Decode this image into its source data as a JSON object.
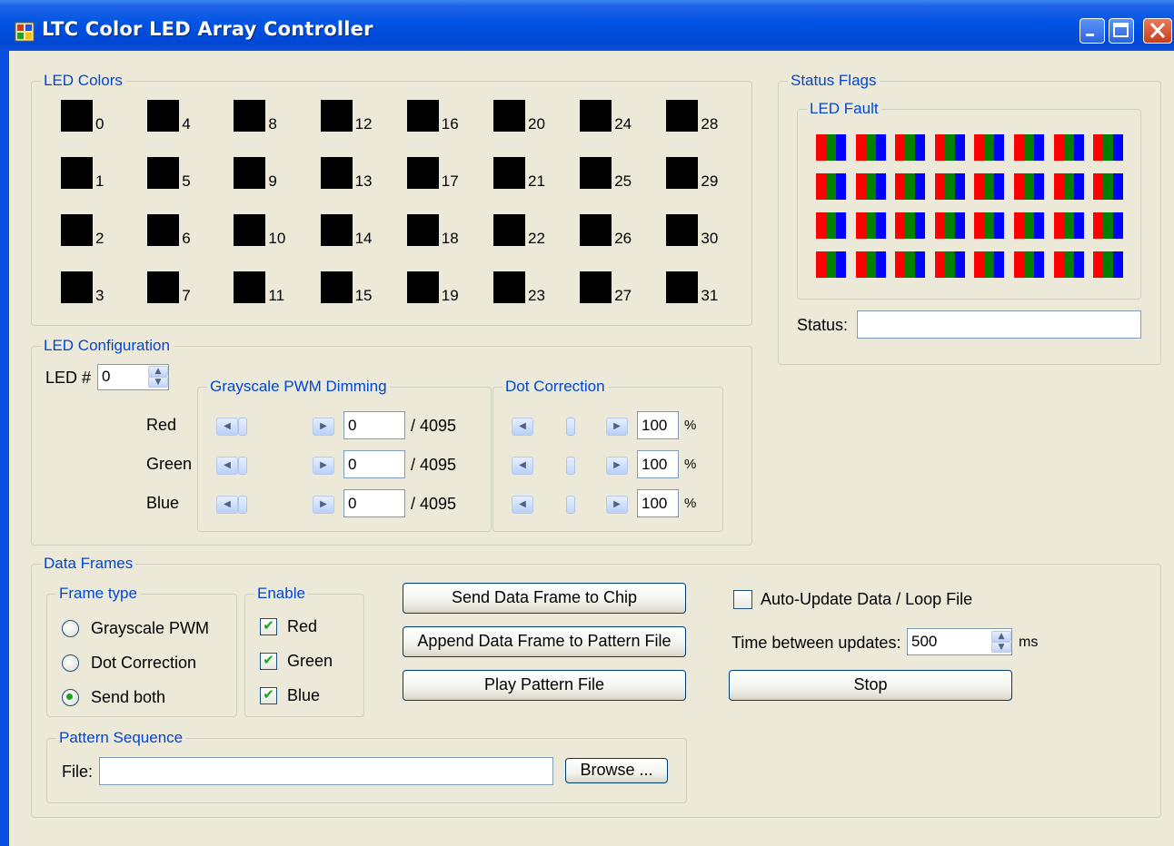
{
  "window": {
    "title": "LTC Color LED Array Controller"
  },
  "led_colors": {
    "label": "LED Colors",
    "leds": [
      {
        "num": "0",
        "col": 0,
        "row": 0
      },
      {
        "num": "1",
        "col": 0,
        "row": 1
      },
      {
        "num": "2",
        "col": 0,
        "row": 2
      },
      {
        "num": "3",
        "col": 0,
        "row": 3
      },
      {
        "num": "4",
        "col": 1,
        "row": 0
      },
      {
        "num": "5",
        "col": 1,
        "row": 1
      },
      {
        "num": "6",
        "col": 1,
        "row": 2
      },
      {
        "num": "7",
        "col": 1,
        "row": 3
      },
      {
        "num": "8",
        "col": 2,
        "row": 0
      },
      {
        "num": "9",
        "col": 2,
        "row": 1
      },
      {
        "num": "10",
        "col": 2,
        "row": 2
      },
      {
        "num": "11",
        "col": 2,
        "row": 3
      },
      {
        "num": "12",
        "col": 3,
        "row": 0
      },
      {
        "num": "13",
        "col": 3,
        "row": 1
      },
      {
        "num": "14",
        "col": 3,
        "row": 2
      },
      {
        "num": "15",
        "col": 3,
        "row": 3
      },
      {
        "num": "16",
        "col": 4,
        "row": 0
      },
      {
        "num": "17",
        "col": 4,
        "row": 1
      },
      {
        "num": "18",
        "col": 4,
        "row": 2
      },
      {
        "num": "19",
        "col": 4,
        "row": 3
      },
      {
        "num": "20",
        "col": 5,
        "row": 0
      },
      {
        "num": "21",
        "col": 5,
        "row": 1
      },
      {
        "num": "22",
        "col": 5,
        "row": 2
      },
      {
        "num": "23",
        "col": 5,
        "row": 3
      },
      {
        "num": "24",
        "col": 6,
        "row": 0
      },
      {
        "num": "25",
        "col": 6,
        "row": 1
      },
      {
        "num": "26",
        "col": 6,
        "row": 2
      },
      {
        "num": "27",
        "col": 6,
        "row": 3
      },
      {
        "num": "28",
        "col": 7,
        "row": 0
      },
      {
        "num": "29",
        "col": 7,
        "row": 1
      },
      {
        "num": "30",
        "col": 7,
        "row": 2
      },
      {
        "num": "31",
        "col": 7,
        "row": 3
      }
    ],
    "led_color": "#000000"
  },
  "status_flags": {
    "label": "Status Flags",
    "led_fault": {
      "label": "LED Fault",
      "colors": [
        "#ff0000",
        "#008000",
        "#0000ff"
      ],
      "rows": 4,
      "cols": 8
    },
    "status_label": "Status:",
    "status_value": ""
  },
  "led_config": {
    "label": "LED Configuration",
    "led_num_label": "LED #",
    "led_num_value": "0",
    "grayscale": {
      "label": "Grayscale PWM Dimming",
      "rows": [
        {
          "color": "Red",
          "value": "0",
          "max": "/ 4095",
          "level": 0
        },
        {
          "color": "Green",
          "value": "0",
          "max": "/ 4095",
          "level": 0
        },
        {
          "color": "Blue",
          "value": "0",
          "max": "/ 4095",
          "level": 0
        }
      ]
    },
    "dot_correction": {
      "label": "Dot Correction",
      "unit": "%",
      "rows": [
        {
          "value": "100"
        },
        {
          "value": "100"
        },
        {
          "value": "100"
        }
      ]
    }
  },
  "data_frames": {
    "label": "Data Frames",
    "frame_type": {
      "label": "Frame type",
      "options": [
        {
          "label": "Grayscale PWM",
          "selected": false
        },
        {
          "label": "Dot Correction",
          "selected": false
        },
        {
          "label": "Send both",
          "selected": true
        }
      ]
    },
    "enable": {
      "label": "Enable",
      "options": [
        {
          "label": "Red",
          "checked": true
        },
        {
          "label": "Green",
          "checked": true
        },
        {
          "label": "Blue",
          "checked": true
        }
      ]
    },
    "buttons": {
      "send": "Send Data Frame to Chip",
      "append": "Append Data Frame to Pattern File",
      "play": "Play Pattern File",
      "stop": "Stop"
    },
    "auto_update": {
      "label": "Auto-Update Data  /  Loop File",
      "checked": false
    },
    "time_between": {
      "label": "Time between updates:",
      "value": "500",
      "unit": "ms"
    },
    "pattern": {
      "label": "Pattern Sequence",
      "file_label": "File:",
      "file_value": "",
      "browse": "Browse ..."
    }
  }
}
